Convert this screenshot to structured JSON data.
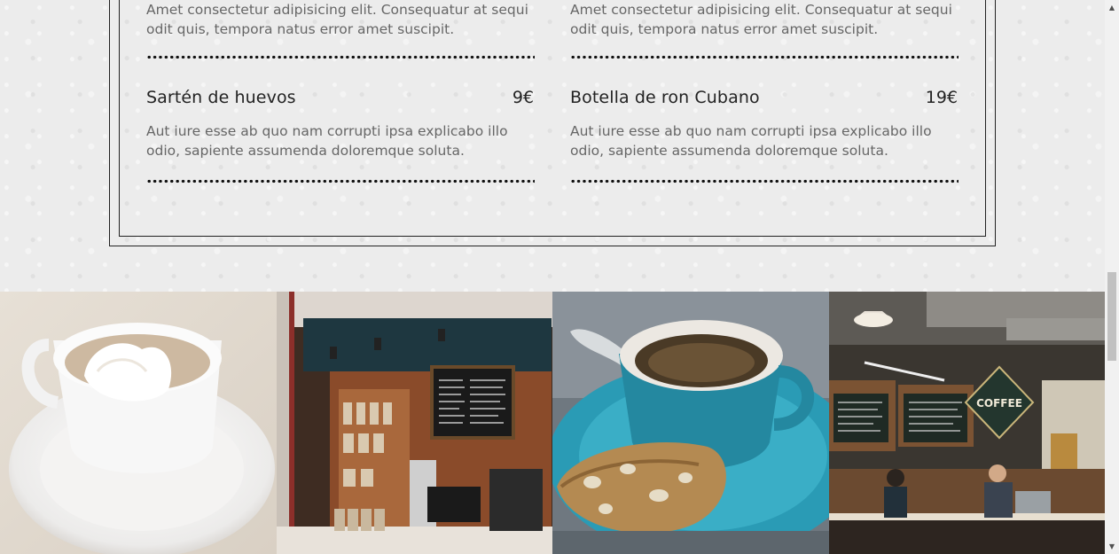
{
  "menu": {
    "items": [
      {
        "title": "",
        "price": "",
        "desc": "Amet consectetur adipisicing elit. Consequatur at sequi odit quis, tempora natus error amet suscipit."
      },
      {
        "title": "",
        "price": "",
        "desc": "Amet consectetur adipisicing elit. Consequatur at sequi odit quis, tempora natus error amet suscipit."
      },
      {
        "title": "Sartén de huevos",
        "price": "9€",
        "desc": "Aut iure esse ab quo nam corrupti ipsa explicabo illo odio, sapiente assumenda doloremque soluta."
      },
      {
        "title": "Botella de ron Cubano",
        "price": "19€",
        "desc": "Aut iure esse ab quo nam corrupti ipsa explicabo illo odio, sapiente assumenda doloremque soluta."
      }
    ]
  },
  "gallery": {
    "images": [
      {
        "name": "cup-with-whipped-cream"
      },
      {
        "name": "coffee-shop-counter"
      },
      {
        "name": "blue-cup-and-biscotti"
      },
      {
        "name": "cafe-interior"
      }
    ],
    "sign_text": "COFFEE"
  },
  "scrollbar": {
    "up": "▲",
    "down": "▼"
  },
  "colors": {
    "background": "#ececec",
    "text": "#222222",
    "desc_text": "#666666",
    "cup_blue": "#2a9bb5"
  }
}
